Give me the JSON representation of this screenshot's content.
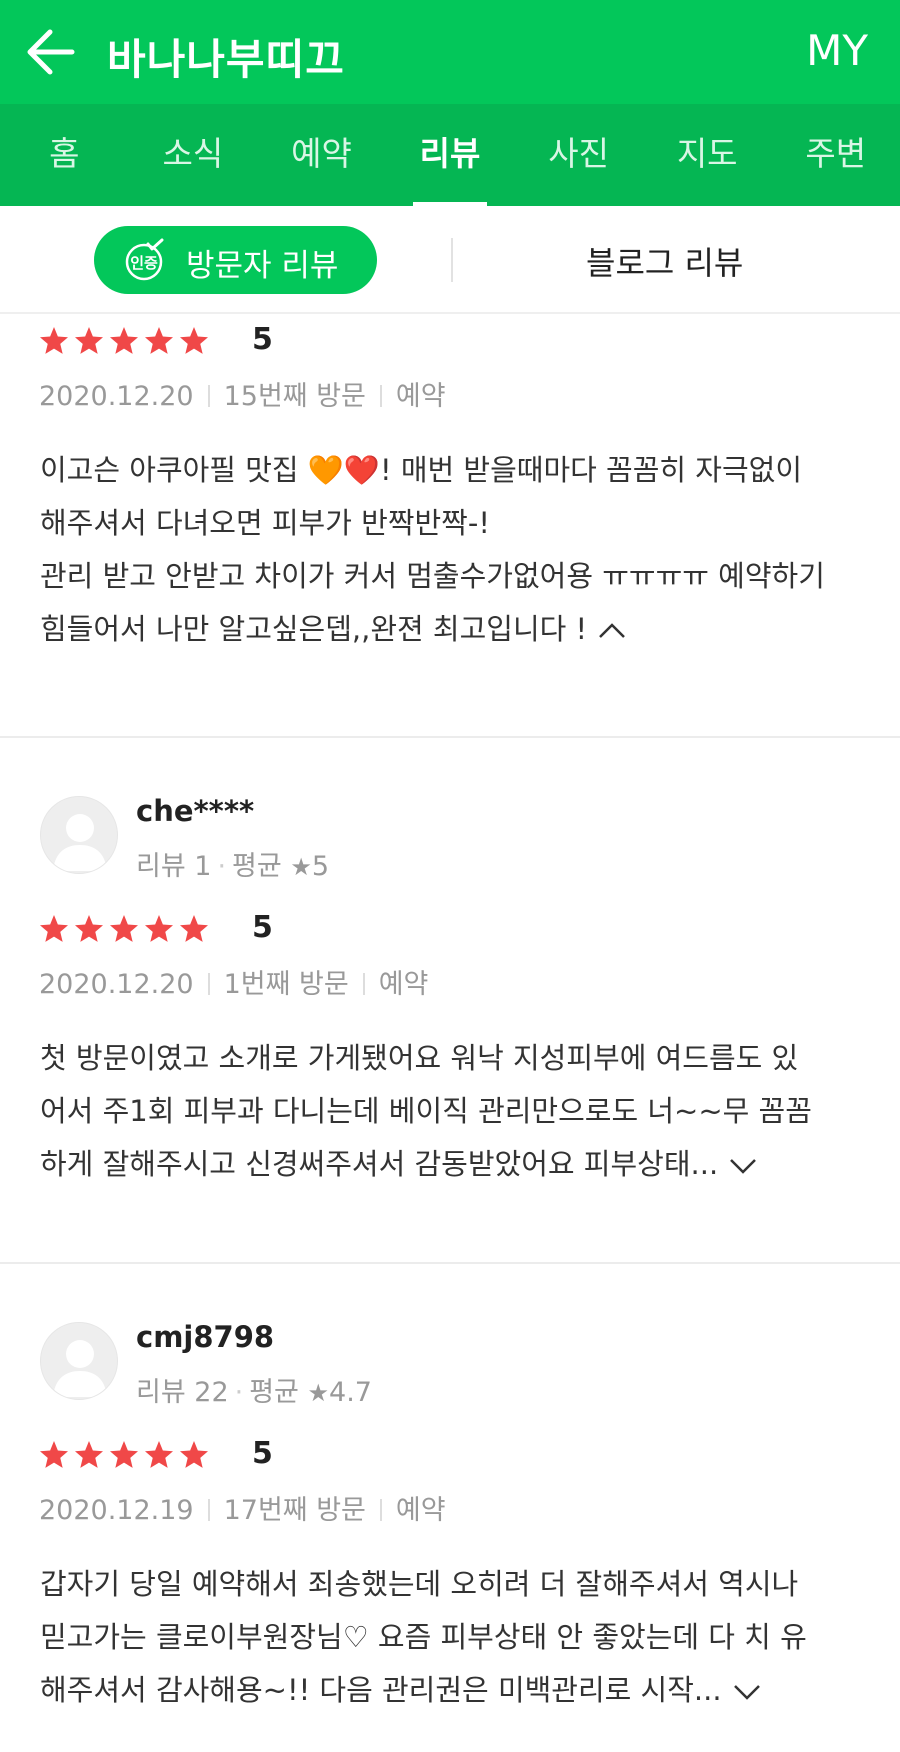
{
  "header": {
    "back_icon": "arrow-left-icon",
    "title": "바나나부띠끄",
    "right_label": "MY"
  },
  "tabs": [
    {
      "label": "홈",
      "active": false
    },
    {
      "label": "소식",
      "active": false
    },
    {
      "label": "예약",
      "active": false
    },
    {
      "label": "리뷰",
      "active": true
    },
    {
      "label": "사진",
      "active": false
    },
    {
      "label": "지도",
      "active": false
    },
    {
      "label": "주변",
      "active": false
    }
  ],
  "review_type": {
    "visitor_badge": "인증",
    "visitor_label": "방문자 리뷰",
    "blog_label": "블로그 리뷰"
  },
  "colors": {
    "brand_green": "#03c75a",
    "tab_bar_green": "#05b653",
    "star_red": "#f04848"
  },
  "reviews": [
    {
      "rating": 5,
      "score": "5",
      "date": "2020.12.20",
      "visit": "15번째 방문",
      "tag": "예약",
      "lines": [
        "이고슨 아쿠아필 맛집 🧡❤️! 매번 받을때마다 꼼꼼히 자극없이",
        "해주셔서 다녀오면 피부가 반짝반짝-!",
        "관리 받고 안받고 차이가 커서 멈출수가없어용 ㅠㅠㅠㅠ 예약하기",
        "힘들어서 나만 알고싶은뎁,,완젼 최고입니다 !"
      ],
      "toggle_icon": "chevron-up-icon"
    },
    {
      "user": {
        "name": "che****",
        "stats_reviews": "리뷰 1",
        "stats_avg_label": "평균",
        "stats_avg": "5",
        "avatar_icon": "default-avatar-icon"
      },
      "rating": 5,
      "score": "5",
      "date": "2020.12.20",
      "visit": "1번째 방문",
      "tag": "예약",
      "lines": [
        "첫 방문이였고 소개로 가게됐어요 워낙 지성피부에 여드름도 있",
        "어서 주1회 피부과 다니는데 베이직 관리만으로도 너~~무 꼼꼼",
        "하게 잘해주시고 신경써주셔서 감동받았어요 피부상태..."
      ],
      "toggle_icon": "chevron-down-icon"
    },
    {
      "user": {
        "name": "cmj8798",
        "stats_reviews": "리뷰 22",
        "stats_avg_label": "평균",
        "stats_avg": "4.7",
        "avatar_icon": "default-avatar-icon"
      },
      "rating": 5,
      "score": "5",
      "date": "2020.12.19",
      "visit": "17번째 방문",
      "tag": "예약",
      "lines": [
        "갑자기 당일 예약해서 죄송했는데 오히려 더 잘해주셔서 역시나",
        "믿고가는 클로이부원장님♡ 요즘 피부상태 안 좋았는데 다 치 유",
        "해주셔서 감사해용~!! 다음 관리권은 미백관리로 시작..."
      ],
      "toggle_icon": "chevron-down-icon"
    }
  ]
}
